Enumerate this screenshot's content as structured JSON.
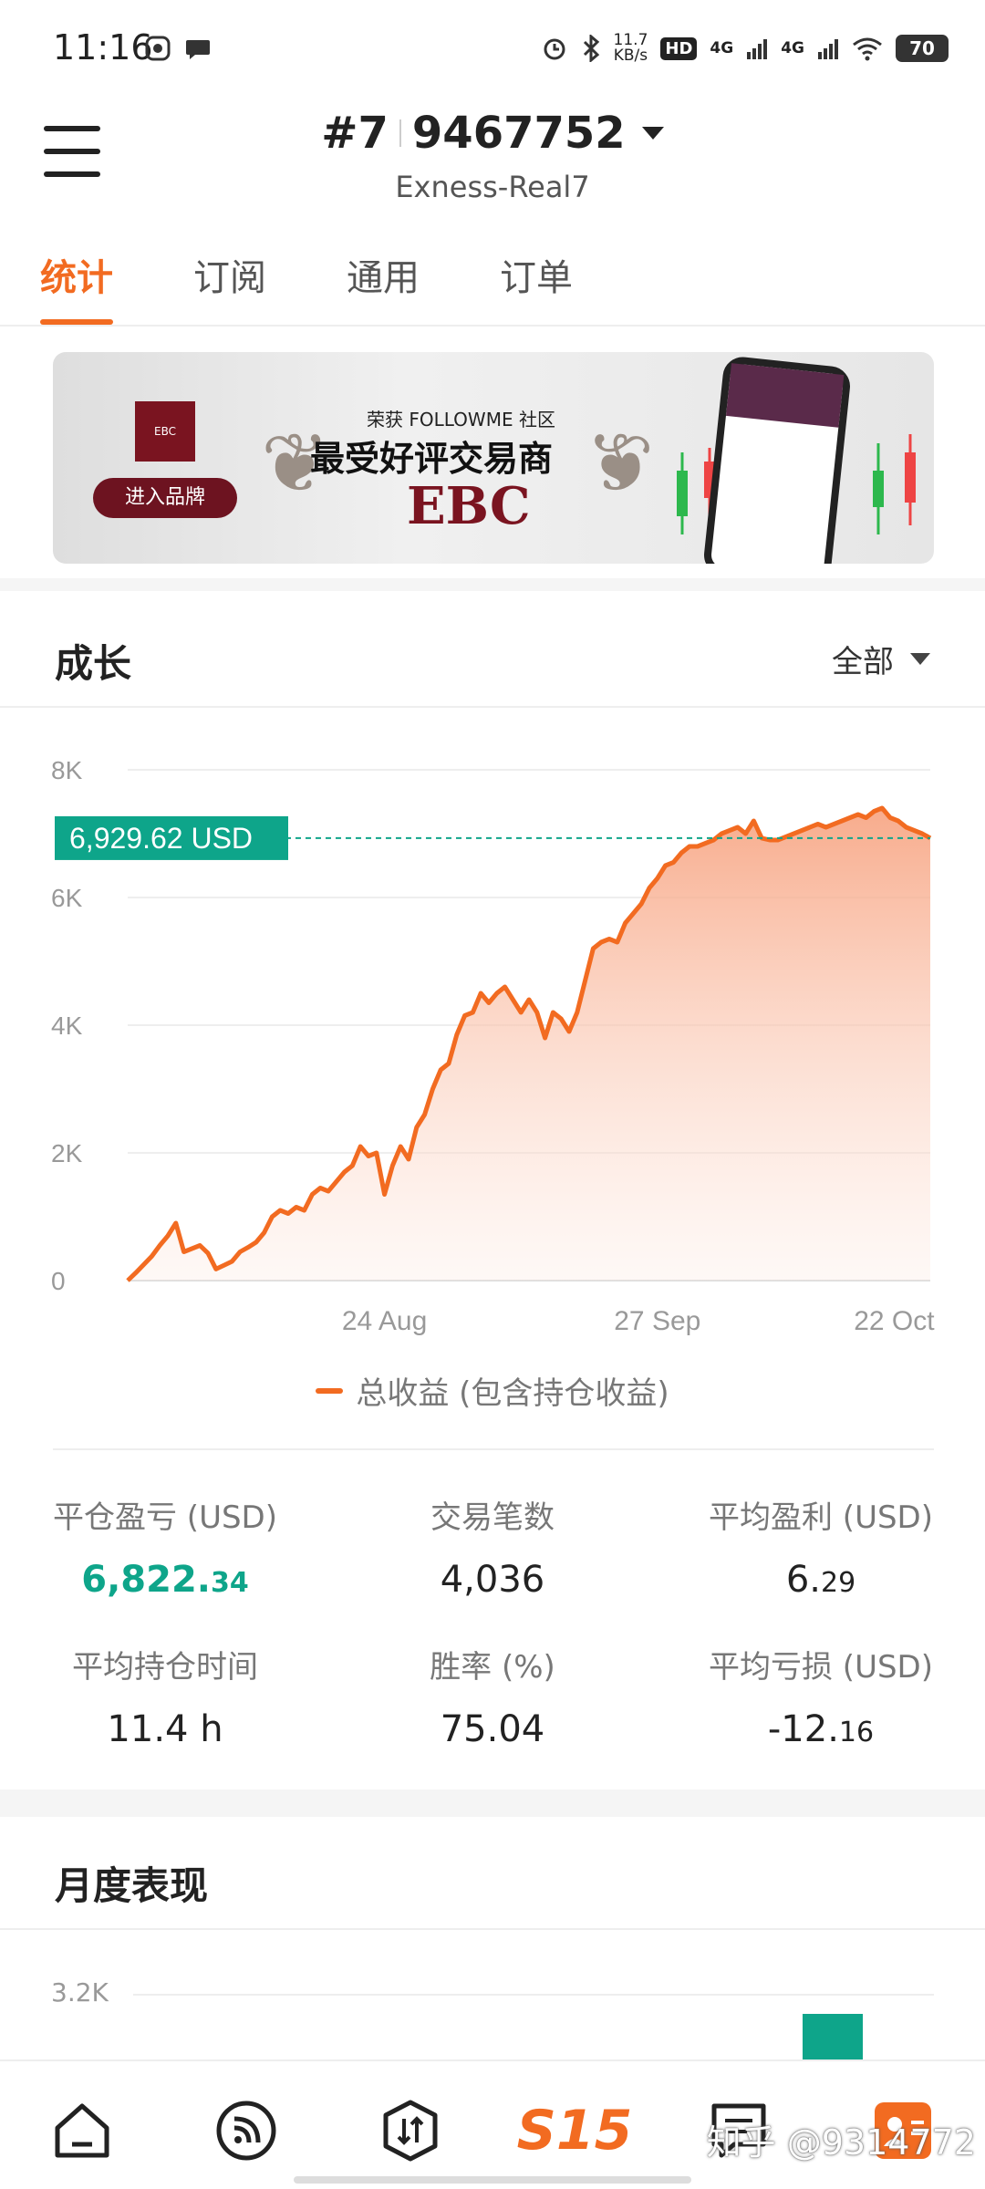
{
  "status_bar": {
    "time": "11:16",
    "speed_value": "11.7",
    "speed_unit": "KB/s",
    "hd_label": "HD",
    "net1": "4G",
    "net2": "4G",
    "battery": "70"
  },
  "header": {
    "account_prefix": "#7",
    "account_number": "9467752",
    "server": "Exness-Real7"
  },
  "tabs": [
    {
      "label": "统计",
      "active": true
    },
    {
      "label": "订阅",
      "active": false
    },
    {
      "label": "通用",
      "active": false
    },
    {
      "label": "订单",
      "active": false
    }
  ],
  "banner": {
    "subtitle": "荣获 FOLLOWME 社区",
    "headline": "最受好评交易商",
    "brand": "EBC",
    "button": "进入品牌"
  },
  "growth": {
    "title": "成长",
    "range": "全部",
    "legend": "总收益 (包含持仓收益)"
  },
  "chart_data": {
    "type": "area",
    "current_label": "6,929.62 USD",
    "current_value": 6929.62,
    "y_ticks": [
      "8K",
      "6K",
      "4K",
      "2K",
      "0"
    ],
    "y_tick_values": [
      8000,
      6000,
      4000,
      2000,
      0
    ],
    "ylim": [
      0,
      8000
    ],
    "x_ticks": [
      "24 Aug",
      "27 Sep",
      "22 Oct"
    ],
    "x_tick_positions": [
      32,
      66,
      95.5
    ],
    "xlim": [
      0,
      100
    ],
    "line_color": "#f26b21",
    "series": [
      {
        "x": [
          0,
          1,
          2,
          3,
          4,
          5,
          6,
          7,
          8,
          9,
          10,
          11,
          12,
          13,
          14,
          15,
          16,
          17,
          18,
          19,
          20,
          21,
          22,
          23,
          24,
          25,
          26,
          27,
          28,
          29,
          30,
          31,
          32,
          33,
          34,
          35,
          36,
          37,
          38,
          39,
          40,
          41,
          42,
          43,
          44,
          45,
          46,
          47,
          48,
          49,
          50,
          51,
          52,
          53,
          54,
          55,
          56,
          57,
          58,
          59,
          60,
          61,
          62,
          63,
          64,
          65,
          66,
          67,
          68,
          69,
          70,
          71,
          72,
          73,
          74,
          75,
          76,
          77,
          78,
          79,
          80,
          81,
          82,
          83,
          84,
          85,
          86,
          87,
          88,
          89,
          90,
          91,
          92,
          93,
          94,
          95,
          96,
          97,
          98,
          99,
          100
        ],
        "values": [
          0,
          120,
          250,
          380,
          550,
          700,
          900,
          450,
          500,
          550,
          430,
          180,
          240,
          300,
          450,
          520,
          600,
          750,
          1000,
          1100,
          1050,
          1150,
          1100,
          1350,
          1450,
          1400,
          1550,
          1700,
          1800,
          2100,
          1950,
          2000,
          1350,
          1800,
          2100,
          1900,
          2400,
          2600,
          3000,
          3300,
          3400,
          3850,
          4150,
          4200,
          4500,
          4350,
          4500,
          4600,
          4400,
          4200,
          4400,
          4200,
          3800,
          4200,
          4100,
          3900,
          4200,
          4700,
          5200,
          5300,
          5350,
          5300,
          5600,
          5750,
          5900,
          6150,
          6300,
          6500,
          6550,
          6700,
          6800,
          6800,
          6850,
          6900,
          7000,
          7050,
          7100,
          7000,
          7200,
          6929.62,
          6900,
          6900,
          6950,
          7000,
          7050,
          7100,
          7150,
          7100,
          7150,
          7200,
          7250,
          7300,
          7250,
          7350,
          7400,
          7250,
          7200,
          7100,
          7050,
          7000,
          6929.62
        ]
      }
    ]
  },
  "stats": [
    {
      "label": "平仓盈亏 (USD)",
      "int": "6,822.",
      "frac": "34",
      "green": true
    },
    {
      "label": "交易笔数",
      "int": "4,036",
      "frac": "",
      "green": false
    },
    {
      "label": "平均盈利 (USD)",
      "int": "6.",
      "frac": "29",
      "green": false
    },
    {
      "label": "平均持仓时间",
      "int": "11.4 h",
      "frac": "",
      "green": false
    },
    {
      "label": "胜率 (%)",
      "int": "75.04",
      "frac": "",
      "green": false
    },
    {
      "label": "平均亏损 (USD)",
      "int": "-12.",
      "frac": "16",
      "green": false
    }
  ],
  "monthly": {
    "title": "月度表现",
    "y_tick": "3.2K"
  },
  "bottom_nav": {
    "s15": "S15",
    "watermark": "知乎 @9314772"
  }
}
